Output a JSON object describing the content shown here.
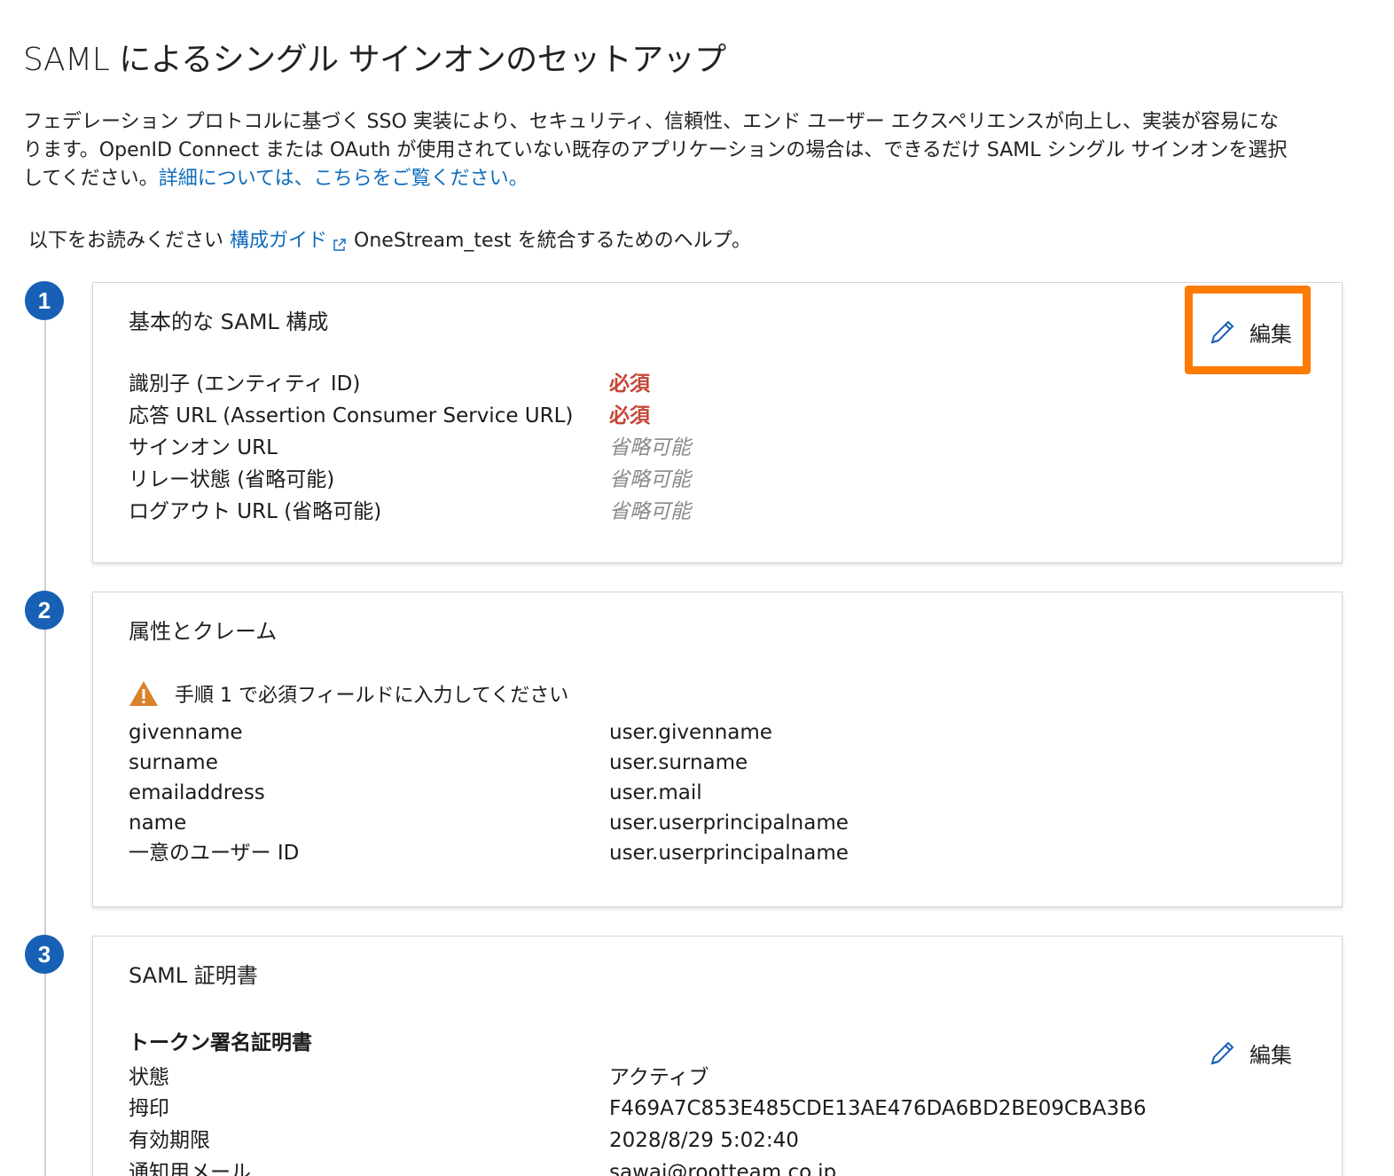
{
  "page": {
    "title": "SAML によるシングル サインオンのセットアップ",
    "intro_line1": "フェデレーション プロトコルに基づく SSO 実装により、セキュリティ、信頼性、エンド ユーザー エクスペリエンスが向上し、実装が容易にな",
    "intro_line2": "ります。OpenID Connect または OAuth が使用されていない既存のアプリケーションの場合は、できるだけ SAML シングル サインオンを選択",
    "intro_line3_prefix": "してください。",
    "intro_link": "詳細については、こちらをご覧ください。",
    "guide_prefix": "以下をお読みください",
    "guide_link": "構成ガイド",
    "guide_suffix": "OneStream_test を統合するためのヘルプ。"
  },
  "colors": {
    "link": "#0f6cbd",
    "step_badge": "#1760b5",
    "required": "#c44737",
    "highlight": "#ff7a00",
    "warning": "#d9822b"
  },
  "steps": [
    {
      "number": "1",
      "title": "基本的な SAML 構成",
      "edit_label": "編集",
      "rows": [
        {
          "label": "識別子 (エンティティ ID)",
          "value": "必須",
          "kind": "required"
        },
        {
          "label": "応答 URL (Assertion Consumer Service URL)",
          "value": "必須",
          "kind": "required"
        },
        {
          "label": "サインオン URL",
          "value": "省略可能",
          "kind": "optional"
        },
        {
          "label": "リレー状態 (省略可能)",
          "value": "省略可能",
          "kind": "optional"
        },
        {
          "label": "ログアウト URL (省略可能)",
          "value": "省略可能",
          "kind": "optional"
        }
      ]
    },
    {
      "number": "2",
      "title": "属性とクレーム",
      "warning": "手順 1 で必須フィールドに入力してください",
      "rows": [
        {
          "label": "givenname",
          "value": "user.givenname"
        },
        {
          "label": "surname",
          "value": "user.surname"
        },
        {
          "label": "emailaddress",
          "value": "user.mail"
        },
        {
          "label": "name",
          "value": "user.userprincipalname"
        },
        {
          "label": "一意のユーザー ID",
          "value": "user.userprincipalname"
        }
      ]
    },
    {
      "number": "3",
      "title": "SAML 証明書",
      "subheading": "トークン署名証明書",
      "edit_label": "編集",
      "rows": [
        {
          "label": "状態",
          "value": "アクティブ"
        },
        {
          "label": "拇印",
          "value": "F469A7C853E485CDE13AE476DA6BD2BE09CBA3B6"
        },
        {
          "label": "有効期限",
          "value": "2028/8/29 5:02:40"
        },
        {
          "label": "通知用メール",
          "value": "sawai@rootteam.co.jp"
        }
      ]
    }
  ]
}
